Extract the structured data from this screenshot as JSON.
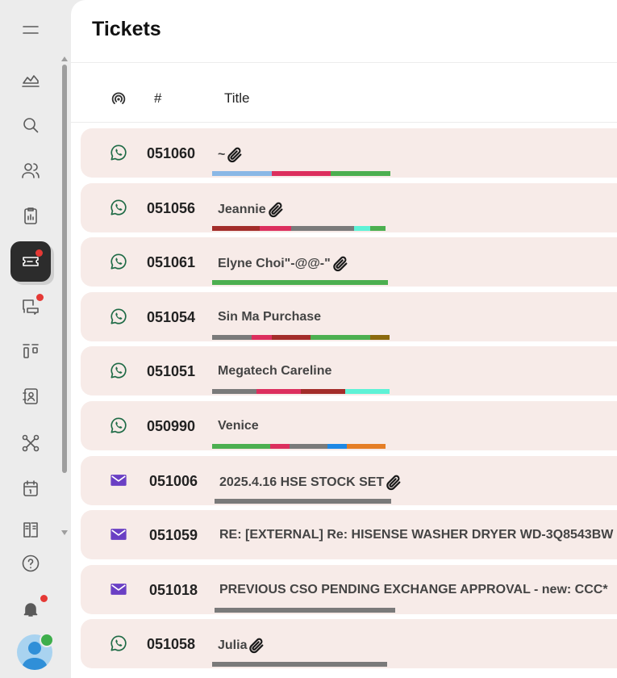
{
  "page": {
    "title": "Tickets"
  },
  "columns": {
    "number": "#",
    "title": "Title"
  },
  "sidebar": {
    "items": [
      {
        "name": "menu",
        "icon": "menu-icon"
      },
      {
        "name": "dashboard",
        "icon": "chart-area-icon"
      },
      {
        "name": "search",
        "icon": "search-icon"
      },
      {
        "name": "contacts",
        "icon": "users-icon"
      },
      {
        "name": "tasks",
        "icon": "clipboard-icon"
      },
      {
        "name": "tickets",
        "icon": "ticket-icon",
        "active": true,
        "badge": true
      },
      {
        "name": "conversations",
        "icon": "chat-icon",
        "badge": true
      },
      {
        "name": "boards",
        "icon": "kanban-icon"
      },
      {
        "name": "address-book",
        "icon": "contact-book-icon"
      },
      {
        "name": "integrations",
        "icon": "network-icon"
      },
      {
        "name": "calendar",
        "icon": "calendar-icon"
      },
      {
        "name": "knowledge-base",
        "icon": "book-icon"
      },
      {
        "name": "help",
        "icon": "help-circle-icon"
      },
      {
        "name": "notifications",
        "icon": "bell-icon",
        "badge": true
      }
    ]
  },
  "tickets": [
    {
      "channel": "whatsapp",
      "number": "051060",
      "title": "~",
      "attachment": true,
      "tags": [
        [
          "#8ab8e6",
          74
        ],
        [
          "#dc2f5e",
          73
        ],
        [
          "#4caf50",
          74
        ]
      ]
    },
    {
      "channel": "whatsapp",
      "number": "051056",
      "title": "Jeannie",
      "attachment": true,
      "tags": [
        [
          "#a32d2a",
          59
        ],
        [
          "#dc2f5e",
          39
        ],
        [
          "#7a7a7a",
          78
        ],
        [
          "#5ef2d6",
          20
        ],
        [
          "#4caf50",
          19
        ]
      ]
    },
    {
      "channel": "whatsapp",
      "number": "051061",
      "title": "Elyne Choi\"-@@-\"",
      "attachment": true,
      "tags": [
        [
          "#4caf50",
          218
        ]
      ]
    },
    {
      "channel": "whatsapp",
      "number": "051054",
      "title": "Sin Ma Purchase",
      "attachment": false,
      "tags": [
        [
          "#7a7a7a",
          49
        ],
        [
          "#dc2f5e",
          25
        ],
        [
          "#a32d2a",
          48
        ],
        [
          "#4caf50",
          74
        ],
        [
          "#8b6a0e",
          24
        ]
      ]
    },
    {
      "channel": "whatsapp",
      "number": "051051",
      "title": "Megatech Careline",
      "attachment": false,
      "tags": [
        [
          "#7a7a7a",
          55
        ],
        [
          "#dc2f5e",
          55
        ],
        [
          "#a32d2a",
          55
        ],
        [
          "#5ef2d6",
          55
        ]
      ]
    },
    {
      "channel": "whatsapp",
      "number": "050990",
      "title": "Venice",
      "attachment": false,
      "tags": [
        [
          "#4caf50",
          72
        ],
        [
          "#dc2f5e",
          24
        ],
        [
          "#7a7a7a",
          47
        ],
        [
          "#1e88e5",
          24
        ],
        [
          "#e57e26",
          48
        ]
      ]
    },
    {
      "channel": "email",
      "number": "051006",
      "title": "2025.4.16 HSE STOCK SET",
      "attachment": true,
      "tags": [
        [
          "#7a7a7a",
          219
        ]
      ]
    },
    {
      "channel": "email",
      "number": "051059",
      "title": "RE: [EXTERNAL] Re: HISENSE WASHER DRYER WD-3Q8543BW",
      "attachment": false,
      "tags": []
    },
    {
      "channel": "email",
      "number": "051018",
      "title": "PREVIOUS CSO PENDING EXCHANGE APPROVAL - new: CCC*",
      "attachment": false,
      "tags": [
        [
          "#7a7a7a",
          224
        ]
      ]
    },
    {
      "channel": "whatsapp",
      "number": "051058",
      "title": "Julia",
      "attachment": true,
      "tags": [
        [
          "#7a7a7a",
          217
        ]
      ]
    }
  ],
  "colors": {
    "whatsapp": "#1f6b46",
    "email": "#6a3fc4",
    "row_bg": "#f7ebe8",
    "badge": "#e53935",
    "active_nav": "#2c2c2c"
  }
}
